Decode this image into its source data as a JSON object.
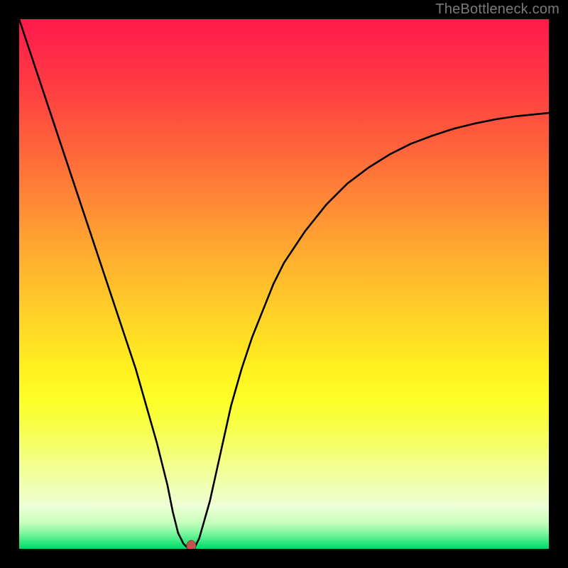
{
  "watermark": "TheBottleneck.com",
  "chart_data": {
    "type": "line",
    "title": "",
    "xlabel": "",
    "ylabel": "",
    "xlim": [
      0,
      100
    ],
    "ylim": [
      0,
      100
    ],
    "series": [
      {
        "name": "bottleneck-curve",
        "x": [
          0,
          2,
          4,
          6,
          8,
          10,
          12,
          14,
          16,
          18,
          20,
          22,
          24,
          26,
          28,
          29,
          30,
          31,
          32,
          33,
          34,
          36,
          38,
          40,
          42,
          44,
          46,
          48,
          50,
          54,
          58,
          62,
          66,
          70,
          74,
          78,
          82,
          86,
          90,
          94,
          98,
          100
        ],
        "values": [
          100,
          94,
          88,
          82,
          76,
          70,
          64,
          58,
          52,
          46,
          40,
          34,
          27,
          20,
          12,
          7,
          3,
          1,
          0,
          0,
          2,
          9,
          18,
          27,
          34,
          40,
          45,
          50,
          54,
          60,
          65,
          69,
          72,
          74.5,
          76.5,
          78,
          79.3,
          80.3,
          81.1,
          81.7,
          82.1,
          82.3
        ]
      }
    ],
    "annotations": [
      {
        "name": "minimum-marker",
        "x": 32.5,
        "y": 0,
        "color": "#c0544f"
      }
    ],
    "background_gradient": {
      "type": "vertical",
      "stops": [
        {
          "pos": 0,
          "color": "#ff1a4a"
        },
        {
          "pos": 50,
          "color": "#ffd228"
        },
        {
          "pos": 70,
          "color": "#fdff28"
        },
        {
          "pos": 90,
          "color": "#edffd6"
        },
        {
          "pos": 100,
          "color": "#00d66a"
        }
      ]
    }
  }
}
